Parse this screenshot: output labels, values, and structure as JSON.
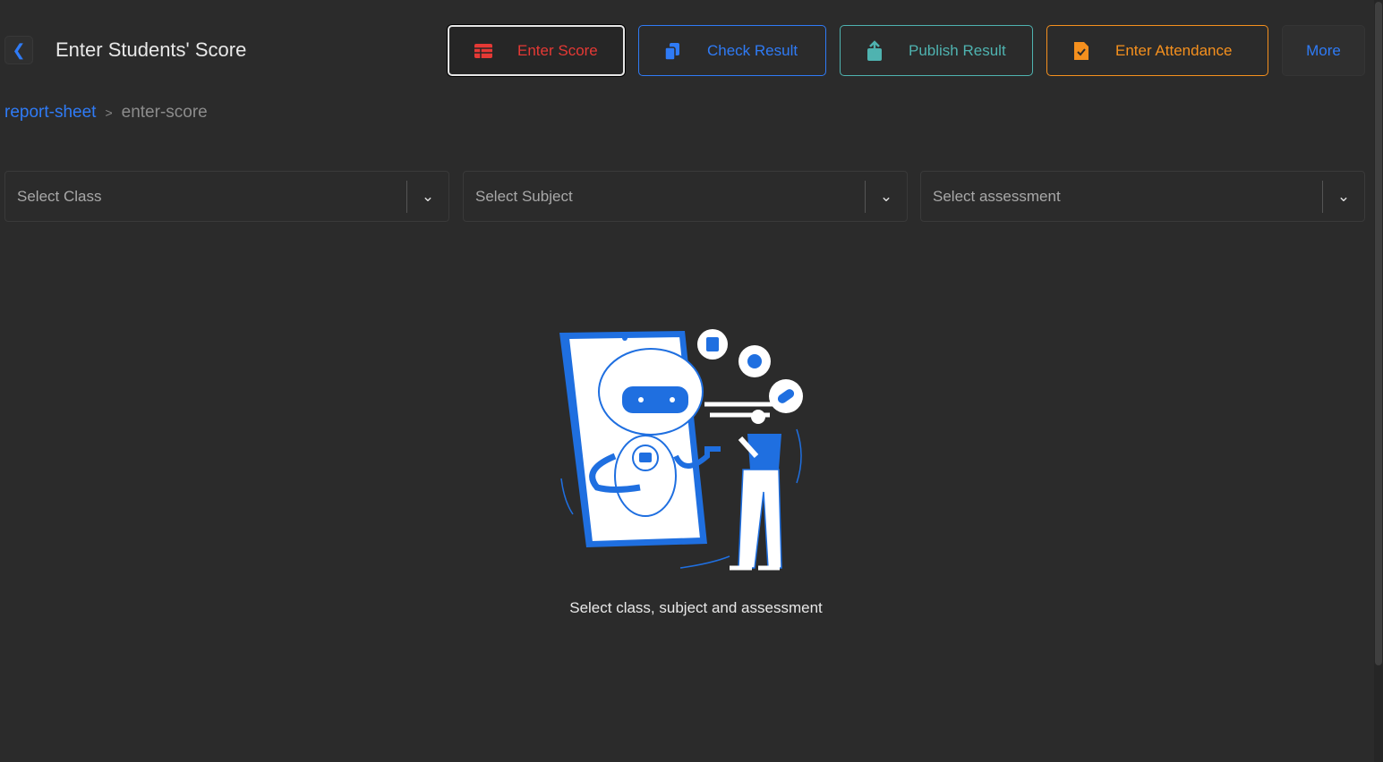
{
  "header": {
    "title": "Enter Students' Score",
    "back_label": "<"
  },
  "actions": [
    {
      "label": "Enter Score",
      "color": "#e53935"
    },
    {
      "label": "Check Result",
      "color": "#2f7bf6"
    },
    {
      "label": "Publish Result",
      "color": "#4fb3b0"
    },
    {
      "label": "Enter Attendance",
      "color": "#f5901e"
    },
    {
      "label": "More",
      "color": "#2f7bf6"
    }
  ],
  "breadcrumb": {
    "parent": "report-sheet",
    "separator": ">",
    "current": "enter-score"
  },
  "filters": [
    {
      "placeholder": "Select Class"
    },
    {
      "placeholder": "Select Subject"
    },
    {
      "placeholder": "Select assessment"
    }
  ],
  "empty_state": {
    "message": "Select class, subject and assessment"
  }
}
